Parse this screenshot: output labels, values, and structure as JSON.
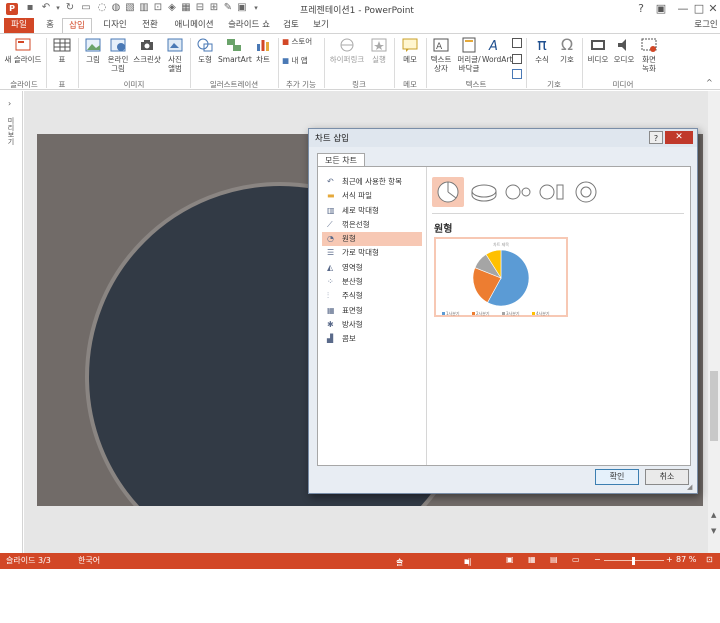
{
  "window": {
    "title": "프레젠테이션1 - PowerPoint",
    "help": "?",
    "minimize": "—",
    "restore": "□",
    "close": "✕"
  },
  "tabs": [
    "파일",
    "홈",
    "삽입",
    "디자인",
    "전환",
    "애니메이션",
    "슬라이드 쇼",
    "검토",
    "보기"
  ],
  "signin": "로그인",
  "ribbon": {
    "new_slide": "새 슬라이드",
    "table": "표",
    "picture": "그림",
    "online_picture_1": "온라인",
    "online_picture_2": "그림",
    "screenshot": "스크린샷",
    "album_1": "사진",
    "album_2": "앨범",
    "shapes": "도형",
    "smartart": "SmartArt",
    "chart": "차트",
    "store": "스토어",
    "my_apps": "내 앱",
    "hyperlink": "하이퍼링크",
    "action": "실행",
    "comment": "메모",
    "textbox_1": "텍스트",
    "textbox_2": "상자",
    "header_1": "머리글/",
    "header_2": "바닥글",
    "wordart": "WordArt",
    "equation": "수식",
    "symbol": "기호",
    "video": "비디오",
    "audio": "오디오",
    "recording_1": "화면",
    "recording_2": "녹화",
    "groups": {
      "slides": "슬라이드",
      "tables": "표",
      "images": "이미지",
      "illustrations": "일러스트레이션",
      "addins": "추가 기능",
      "links": "링크",
      "comments": "메모",
      "text": "텍스트",
      "symbols": "기호",
      "media": "미디어"
    }
  },
  "left_panel_label": "미리보기",
  "dialog": {
    "title": "차트 삽입",
    "tab": "모든 차트",
    "categories": [
      "최근에 사용한 항목",
      "서식 파일",
      "세로 막대형",
      "꺾은선형",
      "원형",
      "가로 막대형",
      "영역형",
      "분산형",
      "주식형",
      "표면형",
      "방사형",
      "콤보"
    ],
    "category_icons": [
      "recent-icon",
      "template-icon",
      "column-chart-icon",
      "line-chart-icon",
      "pie-chart-icon",
      "bar-chart-icon",
      "area-chart-icon",
      "scatter-chart-icon",
      "stock-chart-icon",
      "surface-chart-icon",
      "radar-chart-icon",
      "combo-chart-icon"
    ],
    "selected_category": "원형",
    "subtype_heading": "원형",
    "preview_title": "차트 제목",
    "preview_legend": [
      "1사분기",
      "2사분기",
      "3사분기",
      "4사분기"
    ],
    "ok": "확인",
    "cancel": "취소"
  },
  "status": {
    "slide": "슬라이드 3/3",
    "language": "한국어",
    "notes": "슬라이드 노트",
    "comments": "메모",
    "zoom": "87 %"
  },
  "colors": {
    "accent": "#d24726",
    "selection": "#f7c8b4",
    "slide_bg": "#716b68",
    "circle": "#323a45"
  },
  "chart_data": {
    "type": "pie",
    "title": "차트 제목",
    "categories": [
      "1사분기",
      "2사분기",
      "3사분기",
      "4사분기"
    ],
    "values": [
      58,
      23,
      10,
      9
    ]
  }
}
